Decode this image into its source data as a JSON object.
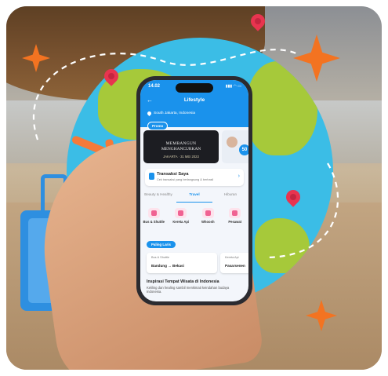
{
  "app": {
    "status_time": "14.02",
    "page_title": "Lifestyle",
    "location": "South Jakarta, Indonesia",
    "promo_chip": "Promo"
  },
  "banner": {
    "line1": "",
    "line2": "MEMBANGUN",
    "line3": "MENGHANCURKAN",
    "line4": "JAKARTA · 31 MEI 2023",
    "badge": "50"
  },
  "transaction": {
    "title": "Transaksi Saya",
    "subtitle": "Cek transaksi yang berlangsung & berhasil"
  },
  "tabs": [
    {
      "label": "Beauty & Healthy"
    },
    {
      "label": "Travel"
    },
    {
      "label": "Hiburan"
    }
  ],
  "categories": [
    {
      "label": "Bus & Shuttle"
    },
    {
      "label": "Kereta Api"
    },
    {
      "label": "Whoosh"
    },
    {
      "label": "Pesawat"
    }
  ],
  "popular": {
    "chip": "Paling Laris",
    "cards": [
      {
        "kind": "Bus & Shuttle",
        "route": "Bandung → Bekasi"
      },
      {
        "kind": "Kereta Api",
        "route": "Pasarsenen"
      }
    ]
  },
  "inspiration": {
    "title": "Inspirasi Tempat Wisata di Indonesia",
    "desc": "Keliling dan healing sambil menikmati keindahan budaya Indonesia."
  },
  "colors": {
    "primary": "#1a92ec",
    "globe": "#3bbde6",
    "land": "#a6c93a",
    "accent": "#f37321",
    "pin": "#e8344f",
    "suitcase": "#2e8fe0"
  }
}
